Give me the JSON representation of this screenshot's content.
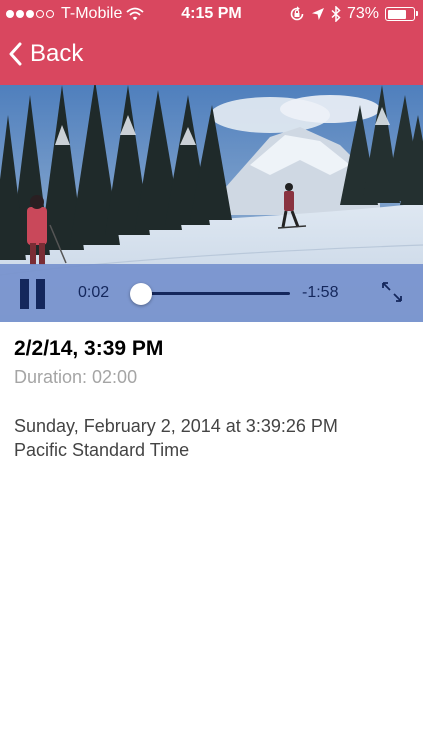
{
  "status_bar": {
    "carrier": "T-Mobile",
    "signal_strength": 3,
    "signal_max": 5,
    "time": "4:15 PM",
    "battery_percent": "73%",
    "battery_level": 0.73,
    "icons": [
      "wifi-icon",
      "orientation-lock-icon",
      "location-arrow-icon",
      "bluetooth-icon",
      "battery-icon"
    ]
  },
  "nav": {
    "back_label": "Back",
    "accent_color": "#d9475f"
  },
  "player": {
    "elapsed": "0:02",
    "remaining": "-1:58",
    "progress": 0.017,
    "state": "playing",
    "icons": [
      "pause-icon",
      "expand-icon"
    ]
  },
  "details": {
    "title": "2/2/14, 3:39 PM",
    "duration": "Duration: 02:00",
    "datetime_line1": "Sunday, February 2, 2014 at 3:39:26 PM",
    "datetime_line2": "Pacific Standard Time"
  }
}
